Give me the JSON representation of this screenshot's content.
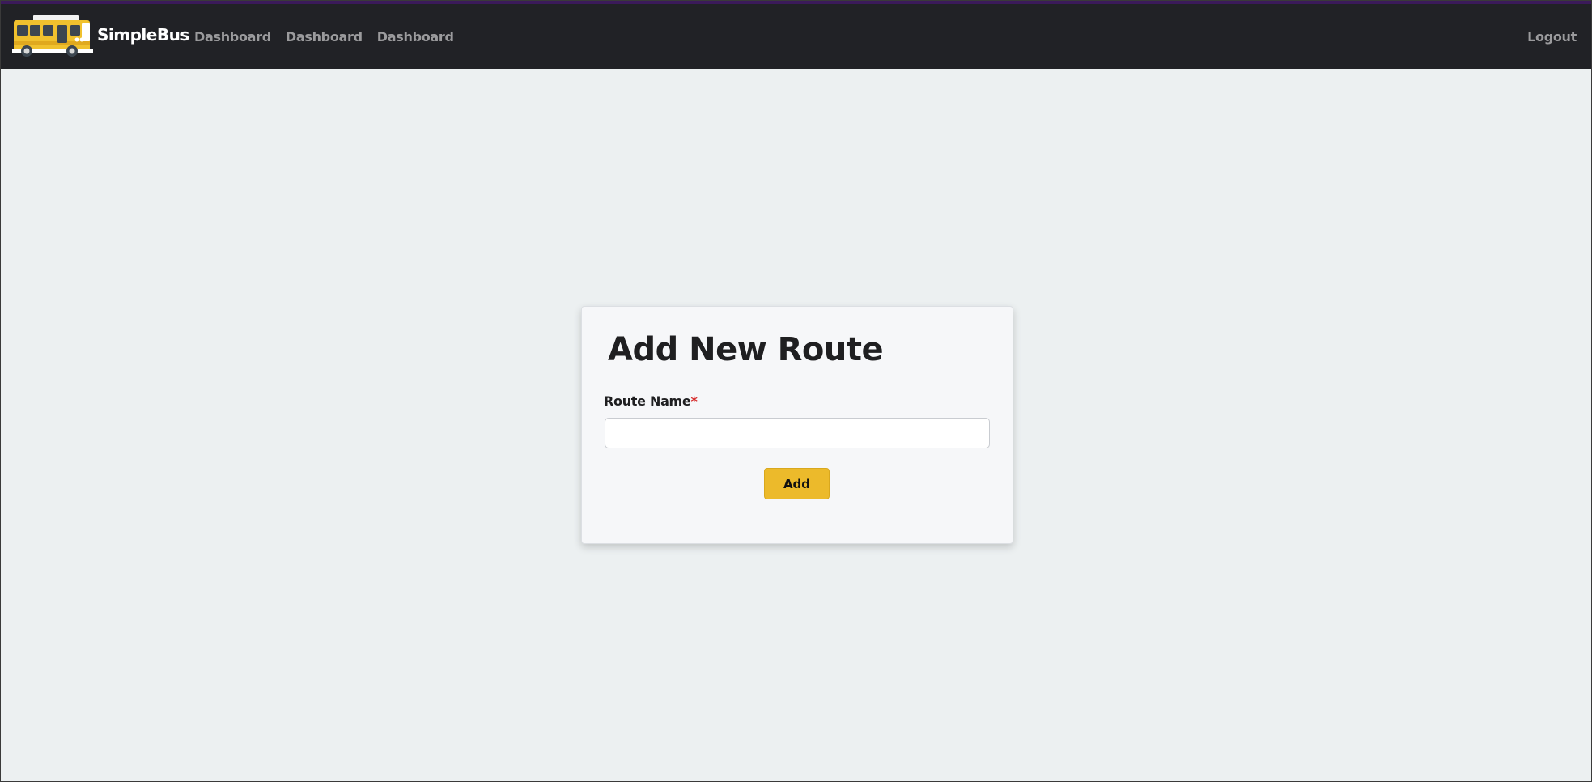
{
  "header": {
    "brand_name": "SimpleBus",
    "logo_icon": "school-bus-icon",
    "nav_links": [
      "Dashboard",
      "Dashboard",
      "Dashboard"
    ],
    "logout_label": "Logout",
    "accent_color": "#3b1a5a",
    "background_color": "#212226"
  },
  "form": {
    "title": "Add New Route",
    "route_name_label": "Route Name",
    "required_marker": "*",
    "route_name_value": "",
    "submit_label": "Add",
    "button_color": "#ecba2b"
  }
}
